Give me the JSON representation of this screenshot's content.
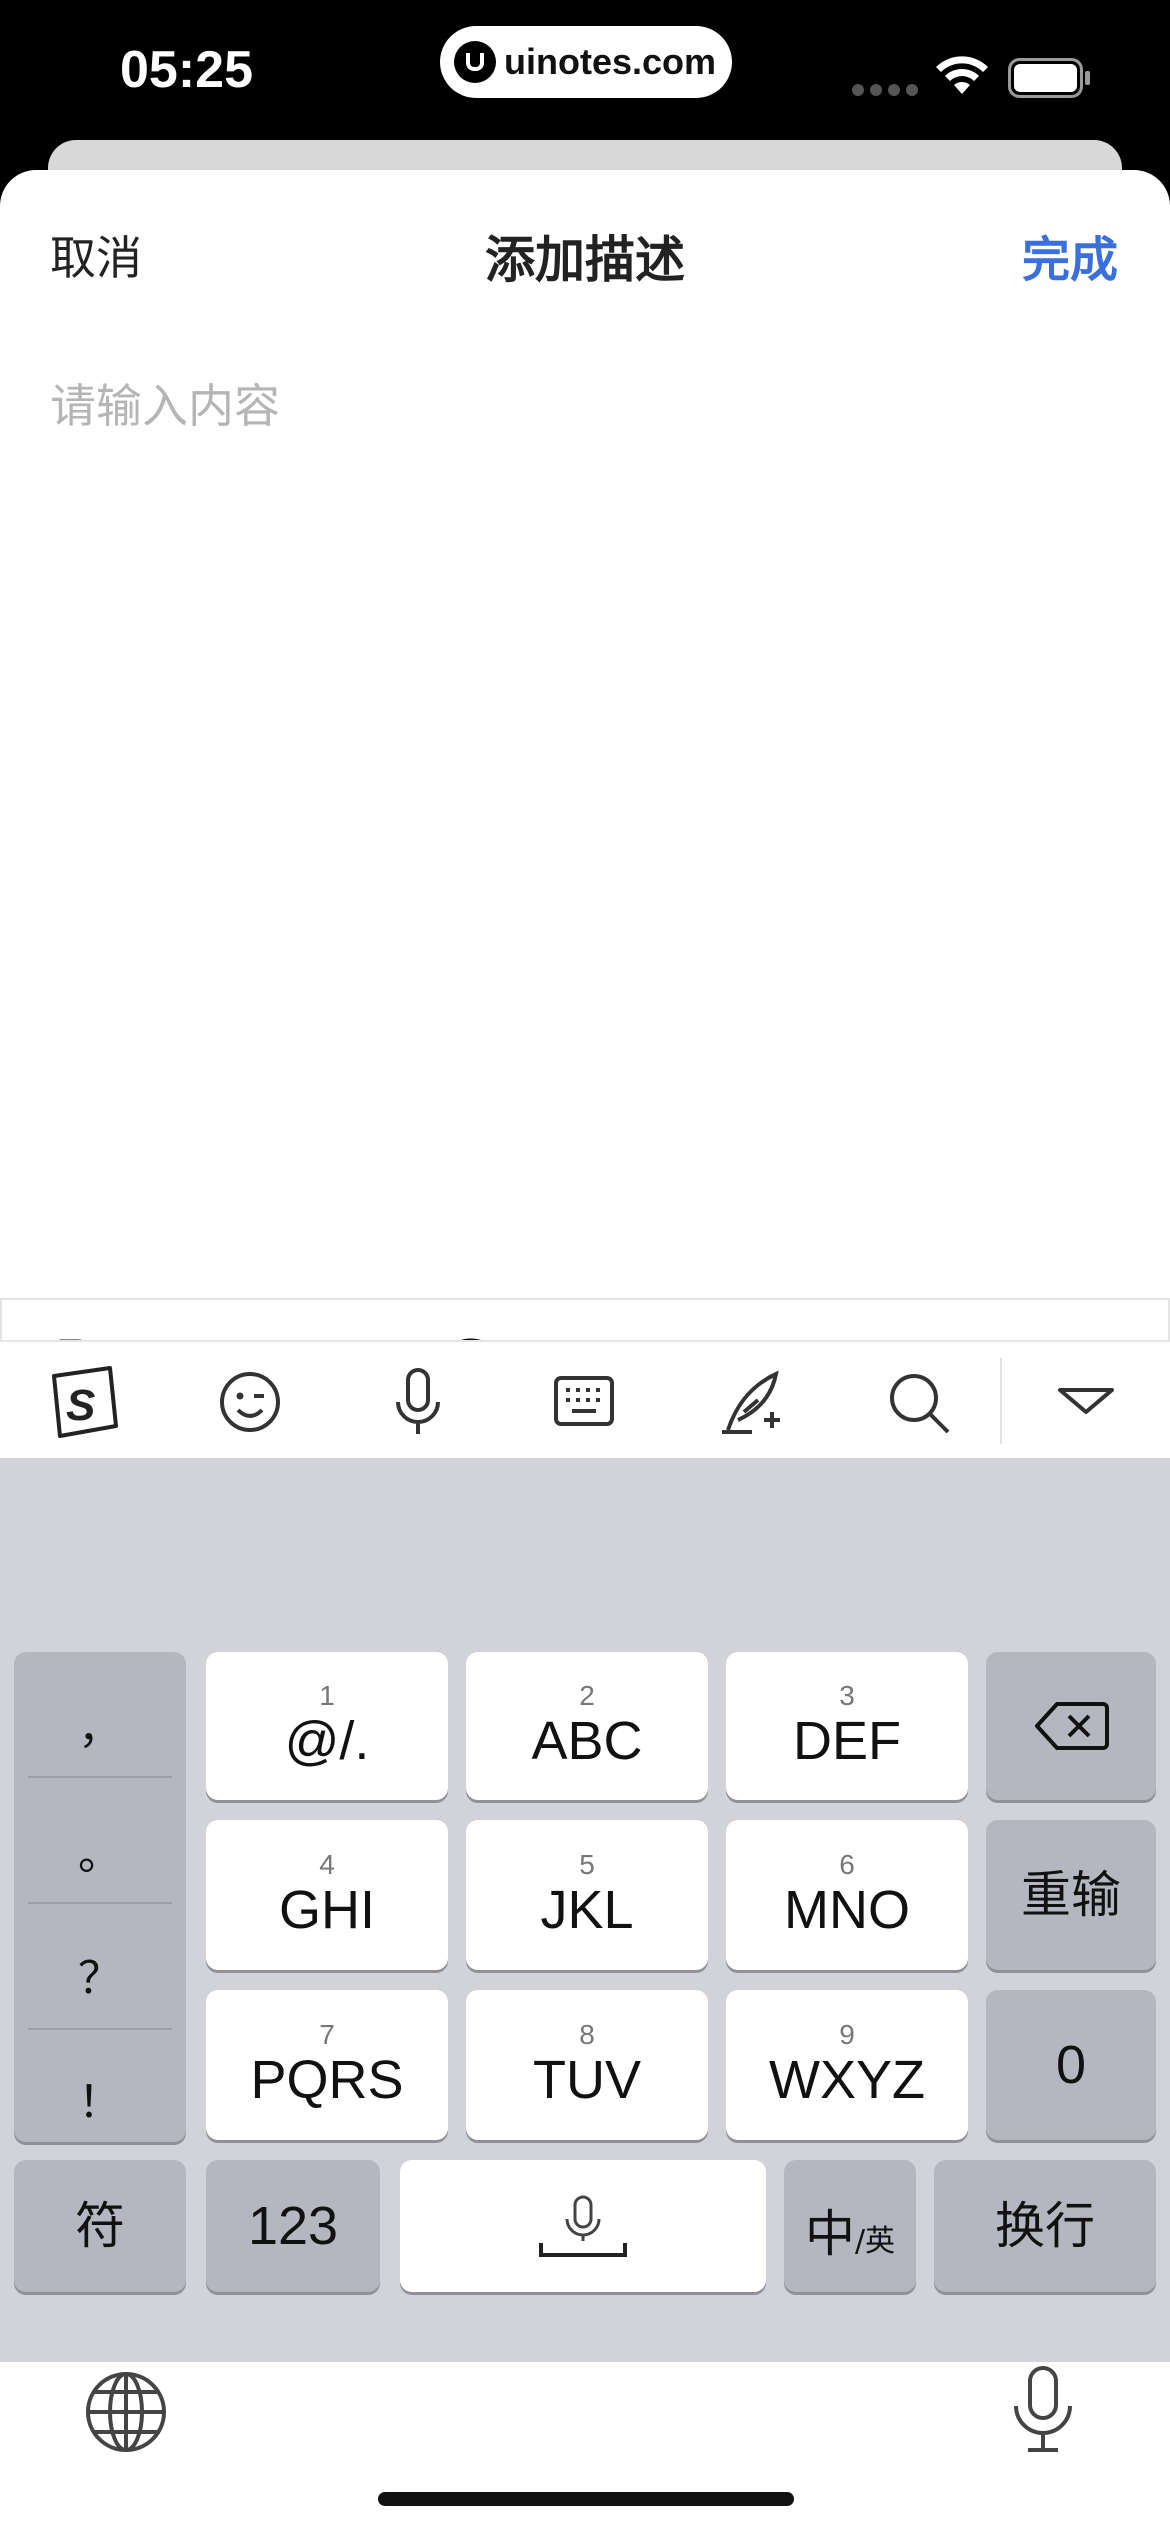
{
  "status_bar": {
    "time": "05:25",
    "url": "uinotes.com",
    "icons": [
      "signal-dots-icon",
      "wifi-icon",
      "battery-icon"
    ]
  },
  "nav": {
    "cancel": "取消",
    "title": "添加描述",
    "done": "完成",
    "done_color": "#3a6fdc"
  },
  "editor": {
    "value": "",
    "placeholder": "请输入内容"
  },
  "format_toolbar": {
    "buttons": [
      "bold-icon",
      "italic-icon",
      "underline-icon",
      "strikethrough-icon",
      "bullet-list-icon",
      "numbered-list-icon",
      "divider-icon"
    ]
  },
  "keyboard": {
    "toolbar_icons": [
      "sogou-logo-icon",
      "emoji-icon",
      "microphone-icon",
      "keyboard-icon",
      "handwriting-icon",
      "search-icon",
      "collapse-chevron-icon"
    ],
    "punctuation": [
      "，",
      "。",
      "？",
      "！"
    ],
    "keys": [
      {
        "num": "1",
        "label": "@/."
      },
      {
        "num": "2",
        "label": "ABC"
      },
      {
        "num": "3",
        "label": "DEF"
      },
      {
        "num": "4",
        "label": "GHI"
      },
      {
        "num": "5",
        "label": "JKL"
      },
      {
        "num": "6",
        "label": "MNO"
      },
      {
        "num": "7",
        "label": "PQRS"
      },
      {
        "num": "8",
        "label": "TUV"
      },
      {
        "num": "9",
        "label": "WXYZ"
      }
    ],
    "reenter": "重输",
    "zero": "0",
    "symbols": "符",
    "numbers": "123",
    "lang_main": "中",
    "lang_sub": "/英",
    "return": "换行"
  }
}
